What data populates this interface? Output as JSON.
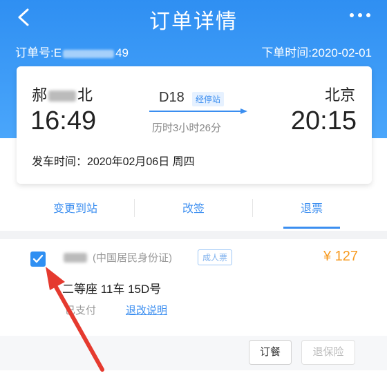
{
  "nav": {
    "title": "订单详情",
    "back_icon": "back-chevron-icon",
    "more_icon": "more-dots-icon"
  },
  "order": {
    "number_prefix": "订单号:E",
    "number_suffix": "49",
    "order_time": "下单时间:2020-02-01"
  },
  "trip": {
    "from_station_prefix": "郝",
    "from_station_suffix": "北",
    "to_station": "北京",
    "from_time": "16:49",
    "to_time": "20:15",
    "train_number": "D18",
    "stop_tag": "经停站",
    "duration": "历时3小时26分",
    "depart_date": "发车时间：2020年02月06日 周四"
  },
  "actions": {
    "change_station": "变更到站",
    "reschedule": "改签",
    "refund": "退票"
  },
  "passenger": {
    "id_type": "(中国居民身份证)",
    "ticket_type": "成人票",
    "price": "¥ 127",
    "seat": "二等座 11车 15D号",
    "pay_status": "已支付",
    "rules_link": "退改说明",
    "checkbox_checked": true
  },
  "bottom": {
    "meal_button": "订餐",
    "insurance_button": "退保险"
  },
  "colors": {
    "primary": "#2f8ff2",
    "price": "#f79a1f",
    "annotation_arrow": "#e53a2f"
  }
}
